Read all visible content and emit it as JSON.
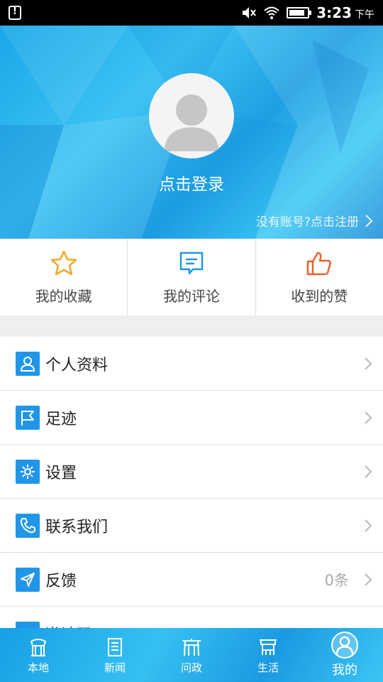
{
  "status_bar": {
    "time": "3:23",
    "ampm": "下午",
    "battery_percent": 85
  },
  "profile": {
    "login_label": "点击登录",
    "register_link": "没有账号?点击注册"
  },
  "quick_actions": [
    {
      "label": "我的收藏",
      "icon": "star-icon",
      "color": "#f5a623"
    },
    {
      "label": "我的评论",
      "icon": "comment-icon",
      "color": "#2196e8"
    },
    {
      "label": "收到的赞",
      "icon": "thumbs-up-icon",
      "color": "#e8612c"
    }
  ],
  "menu": [
    {
      "label": "个人资料",
      "icon": "user-icon",
      "value": ""
    },
    {
      "label": "足迹",
      "icon": "flag-icon",
      "value": ""
    },
    {
      "label": "设置",
      "icon": "gear-icon",
      "value": ""
    },
    {
      "label": "联系我们",
      "icon": "phone-icon",
      "value": ""
    },
    {
      "label": "反馈",
      "icon": "send-icon",
      "value": "0条"
    },
    {
      "label": "邀请码",
      "icon": "invite-icon",
      "value": ""
    }
  ],
  "tabs": [
    {
      "label": "本地",
      "icon": "local-icon",
      "active": false
    },
    {
      "label": "新闻",
      "icon": "news-icon",
      "active": false
    },
    {
      "label": "问政",
      "icon": "gov-icon",
      "active": false
    },
    {
      "label": "生活",
      "icon": "life-icon",
      "active": false
    },
    {
      "label": "我的",
      "icon": "profile-icon",
      "active": true
    }
  ],
  "colors": {
    "accent": "#2196e8",
    "header": "#2aaeea"
  }
}
